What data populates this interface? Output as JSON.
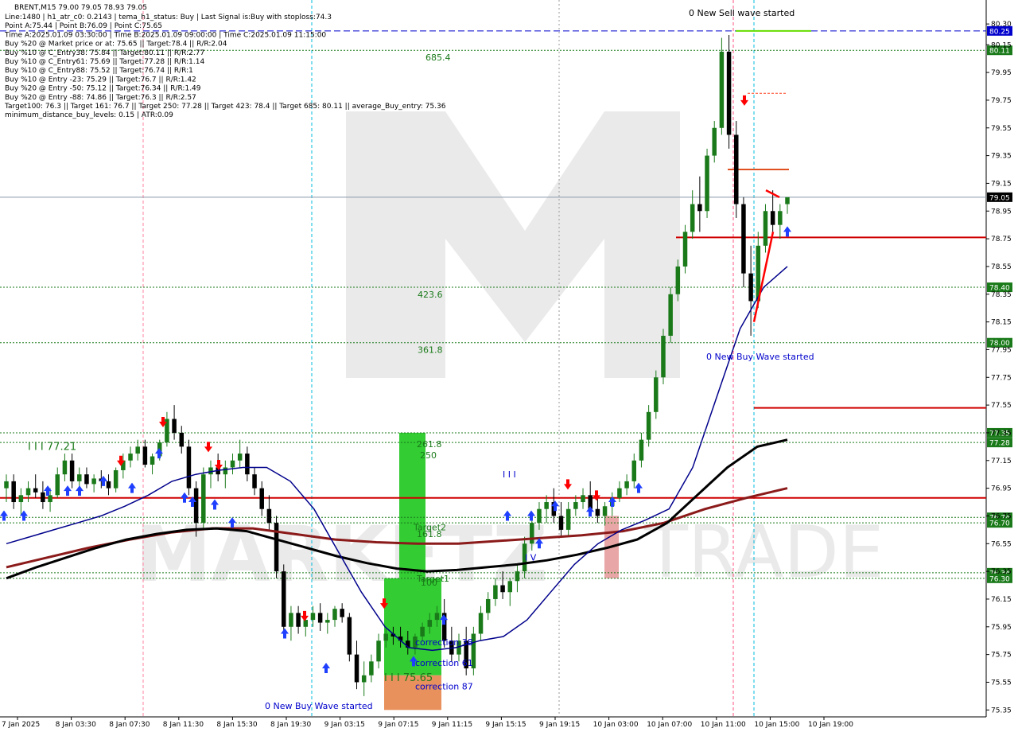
{
  "header": {
    "symbol_line": "BRENT,M15  79.00 79.05 78.93 79.05",
    "info_lines": [
      "Line:1480 | h1_atr_c0: 0.2143 | tema_h1_status: Buy | Last Signal is:Buy with stoploss:74.3",
      "Point A:75.44 | Point B:76.09 | Point C:75.65",
      "Time A:2025.01.09 03:30:00 | Time B:2025.01.09 09:00:00 | Time C:2025.01.09 11:15:00",
      "Buy %20 @ Market price or at: 75.65 || Target:78.4 || R/R:2.04",
      "Buy %10 @ C_Entry38: 75.84 || Target:80.11 || R/R:2.77",
      "Buy %10 @ C_Entry61: 75.69 || Target:77.28 || R/R:1.14",
      "Buy %10 @ C_Entry88: 75.52 || Target:76.74 || R/R:1",
      "Buy %10 @ Entry -23: 75.29 || Target:76.7 || R/R:1.42",
      "Buy %20 @ Entry -50: 75.12 || Target:76.34 || R/R:1.49",
      "Buy %20 @ Entry -88: 74.86 || Target:76.3 || R/R:2.57",
      "Target100: 76.3 || Target 161: 76.7 || Target 250: 77.28 || Target 423: 78.4 || Target 685: 80.11 || average_Buy_entry: 75.36",
      "minimum_distance_buy_levels: 0.15 | ATR:0.09"
    ]
  },
  "colors": {
    "bull": "#1a7a1a",
    "bear": "#000000",
    "blue_ma": "#00008b",
    "black_ma": "#000000",
    "brown_ma": "#8b1a1a",
    "level_red": "#d00000",
    "level_green": "#1a7a1a",
    "level_blue": "#0000cc",
    "green_zone": "#33cc33",
    "salmon_zone": "#e8915c",
    "watermark": "#d9d9d9",
    "arrow_blue": "#1f3fff",
    "arrow_red": "#ff0000"
  },
  "chart_data": {
    "type": "candlestick",
    "ylim": [
      75.3,
      80.45
    ],
    "y_ticks": [
      80.3,
      80.15,
      79.95,
      79.75,
      79.55,
      79.35,
      79.15,
      78.95,
      78.75,
      78.55,
      78.35,
      78.15,
      77.95,
      77.75,
      77.55,
      77.35,
      77.15,
      76.95,
      76.75,
      76.55,
      76.35,
      76.15,
      75.95,
      75.75,
      75.55,
      75.35
    ],
    "x_labels": [
      "7 Jan 2025",
      "8 Jan 03:30",
      "8 Jan 07:30",
      "8 Jan 11:30",
      "8 Jan 15:30",
      "8 Jan 19:30",
      "9 Jan 03:15",
      "9 Jan 07:15",
      "9 Jan 11:15",
      "9 Jan 15:15",
      "9 Jan 19:15",
      "10 Jan 03:00",
      "10 Jan 07:00",
      "10 Jan 11:00",
      "10 Jan 15:00",
      "10 Jan 19:00"
    ],
    "candles": [
      [
        76.95,
        77.05,
        76.85,
        77.0
      ],
      [
        77.0,
        77.05,
        76.8,
        76.85
      ],
      [
        76.85,
        76.95,
        76.75,
        76.9
      ],
      [
        76.9,
        77.0,
        76.85,
        76.95
      ],
      [
        76.95,
        77.05,
        76.88,
        76.92
      ],
      [
        76.92,
        77.0,
        76.8,
        76.85
      ],
      [
        76.85,
        76.95,
        76.78,
        76.9
      ],
      [
        76.9,
        77.1,
        76.88,
        77.05
      ],
      [
        77.05,
        77.2,
        77.0,
        77.15
      ],
      [
        77.15,
        77.2,
        76.95,
        77.0
      ],
      [
        77.0,
        77.1,
        76.9,
        77.05
      ],
      [
        77.05,
        77.1,
        76.95,
        76.98
      ],
      [
        76.98,
        77.05,
        76.92,
        77.02
      ],
      [
        77.02,
        77.08,
        76.95,
        77.0
      ],
      [
        77.0,
        77.05,
        76.9,
        76.95
      ],
      [
        76.95,
        77.1,
        76.92,
        77.08
      ],
      [
        77.08,
        77.2,
        77.02,
        77.15
      ],
      [
        77.15,
        77.25,
        77.1,
        77.2
      ],
      [
        77.2,
        77.3,
        77.15,
        77.25
      ],
      [
        77.25,
        77.3,
        77.1,
        77.12
      ],
      [
        77.12,
        77.2,
        77.05,
        77.18
      ],
      [
        77.18,
        77.3,
        77.15,
        77.28
      ],
      [
        77.28,
        77.5,
        77.25,
        77.45
      ],
      [
        77.45,
        77.55,
        77.3,
        77.35
      ],
      [
        77.35,
        77.4,
        77.2,
        77.25
      ],
      [
        77.25,
        77.3,
        76.9,
        76.95
      ],
      [
        76.95,
        77.0,
        76.6,
        76.7
      ],
      [
        76.7,
        77.1,
        76.65,
        77.05
      ],
      [
        77.05,
        77.15,
        76.95,
        77.1
      ],
      [
        77.1,
        77.2,
        77.0,
        77.05
      ],
      [
        77.05,
        77.15,
        76.95,
        77.1
      ],
      [
        77.1,
        77.2,
        77.05,
        77.15
      ],
      [
        77.15,
        77.3,
        77.1,
        77.2
      ],
      [
        77.2,
        77.25,
        77.0,
        77.05
      ],
      [
        77.05,
        77.1,
        76.9,
        76.95
      ],
      [
        76.95,
        77.0,
        76.75,
        76.8
      ],
      [
        76.8,
        76.9,
        76.65,
        76.7
      ],
      [
        76.7,
        76.75,
        76.3,
        76.35
      ],
      [
        76.35,
        76.4,
        75.9,
        75.95
      ],
      [
        75.95,
        76.1,
        75.85,
        76.05
      ],
      [
        76.05,
        76.1,
        75.9,
        75.95
      ],
      [
        75.95,
        76.05,
        75.88,
        76.0
      ],
      [
        76.0,
        76.1,
        75.95,
        76.05
      ],
      [
        76.05,
        76.12,
        75.92,
        75.98
      ],
      [
        75.98,
        76.05,
        75.9,
        76.0
      ],
      [
        76.0,
        76.1,
        75.95,
        76.08
      ],
      [
        76.08,
        76.12,
        75.98,
        76.02
      ],
      [
        76.02,
        76.05,
        75.7,
        75.75
      ],
      [
        75.75,
        75.85,
        75.5,
        75.55
      ],
      [
        75.55,
        75.7,
        75.45,
        75.6
      ],
      [
        75.6,
        75.75,
        75.55,
        75.7
      ],
      [
        75.7,
        75.9,
        75.65,
        75.85
      ],
      [
        75.85,
        75.95,
        75.8,
        75.9
      ],
      [
        75.9,
        75.95,
        75.82,
        75.88
      ],
      [
        75.88,
        75.95,
        75.8,
        75.85
      ],
      [
        75.85,
        75.92,
        75.75,
        75.8
      ],
      [
        75.8,
        75.9,
        75.75,
        75.88
      ],
      [
        75.88,
        75.98,
        75.85,
        75.95
      ],
      [
        75.95,
        76.05,
        75.9,
        76.0
      ],
      [
        76.0,
        76.1,
        75.95,
        76.05
      ],
      [
        76.05,
        76.15,
        75.8,
        75.85
      ],
      [
        75.85,
        75.95,
        75.7,
        75.75
      ],
      [
        75.75,
        75.9,
        75.7,
        75.85
      ],
      [
        75.85,
        75.95,
        75.6,
        75.65
      ],
      [
        75.65,
        75.95,
        75.6,
        75.9
      ],
      [
        75.9,
        76.1,
        75.85,
        76.05
      ],
      [
        76.05,
        76.2,
        76.0,
        76.15
      ],
      [
        76.15,
        76.3,
        76.1,
        76.25
      ],
      [
        76.25,
        76.35,
        76.15,
        76.2
      ],
      [
        76.2,
        76.3,
        76.1,
        76.28
      ],
      [
        76.28,
        76.4,
        76.2,
        76.35
      ],
      [
        76.35,
        76.6,
        76.3,
        76.55
      ],
      [
        76.55,
        76.75,
        76.5,
        76.7
      ],
      [
        76.7,
        76.85,
        76.65,
        76.8
      ],
      [
        76.8,
        76.9,
        76.7,
        76.85
      ],
      [
        76.85,
        76.95,
        76.7,
        76.75
      ],
      [
        76.75,
        76.85,
        76.6,
        76.65
      ],
      [
        76.65,
        76.85,
        76.6,
        76.8
      ],
      [
        76.8,
        76.9,
        76.75,
        76.85
      ],
      [
        76.85,
        76.95,
        76.8,
        76.9
      ],
      [
        76.9,
        77.0,
        76.75,
        76.8
      ],
      [
        76.8,
        76.88,
        76.7,
        76.75
      ],
      [
        76.75,
        76.85,
        76.68,
        76.82
      ],
      [
        76.82,
        76.92,
        76.75,
        76.88
      ],
      [
        76.88,
        77.0,
        76.85,
        76.95
      ],
      [
        76.95,
        77.05,
        76.9,
        77.0
      ],
      [
        77.0,
        77.2,
        76.95,
        77.15
      ],
      [
        77.15,
        77.35,
        77.1,
        77.3
      ],
      [
        77.3,
        77.55,
        77.25,
        77.5
      ],
      [
        77.5,
        77.8,
        77.45,
        77.75
      ],
      [
        77.75,
        78.1,
        77.7,
        78.05
      ],
      [
        78.05,
        78.4,
        78.0,
        78.35
      ],
      [
        78.35,
        78.6,
        78.3,
        78.55
      ],
      [
        78.55,
        78.85,
        78.5,
        78.8
      ],
      [
        78.8,
        79.1,
        78.75,
        79.0
      ],
      [
        79.0,
        79.2,
        78.8,
        78.95
      ],
      [
        78.95,
        79.4,
        78.9,
        79.35
      ],
      [
        79.35,
        79.6,
        79.3,
        79.55
      ],
      [
        79.55,
        80.2,
        79.5,
        80.1
      ],
      [
        80.1,
        80.22,
        79.4,
        79.5
      ],
      [
        79.5,
        79.6,
        78.9,
        79.0
      ],
      [
        79.0,
        79.05,
        78.4,
        78.5
      ],
      [
        78.5,
        78.7,
        78.05,
        78.3
      ],
      [
        78.3,
        78.8,
        78.25,
        78.7
      ],
      [
        78.7,
        79.0,
        78.65,
        78.95
      ],
      [
        78.95,
        79.1,
        78.8,
        78.85
      ],
      [
        78.85,
        79.0,
        78.75,
        78.95
      ],
      [
        79.0,
        79.05,
        78.93,
        79.05
      ]
    ],
    "ma_blue": [
      76.55,
      76.6,
      76.65,
      76.7,
      76.75,
      76.82,
      76.9,
      77.0,
      77.05,
      77.08,
      77.1,
      77.1,
      77.0,
      76.8,
      76.5,
      76.2,
      75.95,
      75.8,
      75.78,
      75.8,
      75.85,
      75.88,
      76.0,
      76.2,
      76.4,
      76.55,
      76.65,
      76.72,
      76.8,
      77.1,
      77.6,
      78.1,
      78.4,
      78.55
    ],
    "ma_black": [
      76.3,
      76.38,
      76.45,
      76.52,
      76.58,
      76.62,
      76.65,
      76.66,
      76.64,
      76.58,
      76.52,
      76.46,
      76.41,
      76.37,
      76.35,
      76.36,
      76.38,
      76.4,
      76.43,
      76.47,
      76.52,
      76.58,
      76.7,
      76.9,
      77.1,
      77.25,
      77.3
    ],
    "ma_brown": [
      76.38,
      76.45,
      76.52,
      76.58,
      76.63,
      76.66,
      76.66,
      76.62,
      76.58,
      76.56,
      76.55,
      76.55,
      76.57,
      76.59,
      76.61,
      76.64,
      76.7,
      76.8,
      76.88,
      76.95
    ],
    "levels": [
      {
        "price": 80.25,
        "style": "blue-dash",
        "label": "80.25"
      },
      {
        "price": 80.11,
        "style": "green-dot",
        "label": "80.11"
      },
      {
        "price": 79.05,
        "style": "grey-solid",
        "label": "79.05"
      },
      {
        "price": 78.4,
        "style": "green-dot",
        "label": "78.40"
      },
      {
        "price": 78.0,
        "style": "green-dot",
        "label": "78.00"
      },
      {
        "price": 77.35,
        "style": "green-dot",
        "label": "77.35"
      },
      {
        "price": 77.28,
        "style": "green-dot",
        "label": "77.28"
      },
      {
        "price": 76.74,
        "style": "green-dot",
        "label": "76.74"
      },
      {
        "price": 76.7,
        "style": "green-dot",
        "label": "76.70"
      },
      {
        "price": 76.34,
        "style": "green-dot",
        "label": "76.34"
      },
      {
        "price": 76.3,
        "style": "green-dot",
        "label": "76.30"
      }
    ],
    "red_lines": [
      76.88,
      78.76
    ],
    "red_short_line": 77.53,
    "annotations": [
      {
        "text": "685.4",
        "price": 80.06,
        "color": "#1a7a1a"
      },
      {
        "text": "423.6",
        "price": 78.35,
        "color": "#1a7a1a"
      },
      {
        "text": "361.8",
        "price": 77.95,
        "color": "#1a7a1a"
      },
      {
        "text": "261.8",
        "price": 77.27,
        "color": "#1a7a1a"
      },
      {
        "text": "250",
        "price": 77.19,
        "color": "#1a7a1a"
      },
      {
        "text": "161.8",
        "price": 76.62,
        "color": "#1a7a1a"
      },
      {
        "text": "Target2",
        "price": 76.67,
        "color": "#1a7a1a"
      },
      {
        "text": "Target1",
        "price": 76.3,
        "color": "#1a7a1a"
      },
      {
        "text": "100",
        "price": 76.27,
        "color": "#1a7a1a"
      },
      {
        "text": "correction 38",
        "price": 75.84,
        "color": "#0000cc"
      },
      {
        "text": "correction 61",
        "price": 75.69,
        "color": "#0000cc"
      },
      {
        "text": "correction 87",
        "price": 75.52,
        "color": "#0000cc"
      },
      {
        "text": "I I I 75.65",
        "price": 75.58,
        "color": "#1a7a1a"
      },
      {
        "text": "I I I 77.21",
        "price": 77.25,
        "color": "#1a7a1a"
      },
      {
        "text": "I I I",
        "price": 77.05,
        "color": "#0000cc"
      },
      {
        "text": "I V",
        "price": 76.45,
        "color": "#0000cc"
      },
      {
        "text": "0 New Sell wave started",
        "price": 80.38,
        "color": "#000000"
      },
      {
        "text": "0 New Buy Wave started",
        "price": 77.9,
        "color": "#0000cc"
      },
      {
        "text": "0 New Buy Wave started",
        "price": 75.38,
        "color": "#0000cc"
      }
    ]
  }
}
